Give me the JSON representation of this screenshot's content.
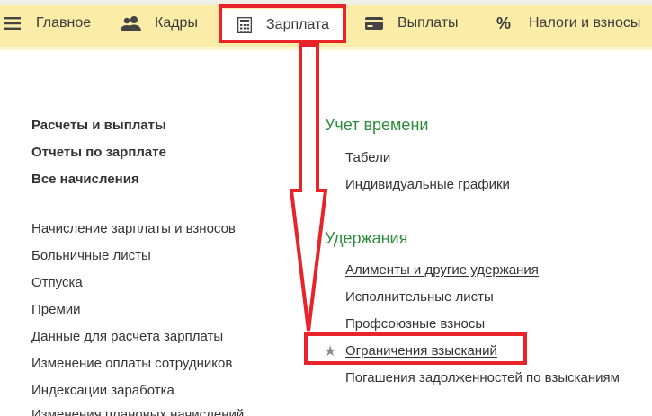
{
  "menu": {
    "items": [
      {
        "label": "Главное",
        "icon": "hamburger-icon"
      },
      {
        "label": "Кадры",
        "icon": "people-icon"
      },
      {
        "label": "Зарплата",
        "icon": "calculator-icon",
        "selected": true
      },
      {
        "label": "Выплаты",
        "icon": "card-icon"
      },
      {
        "label": "Налоги и взносы",
        "icon": "percent-icon",
        "glyph": "%"
      }
    ]
  },
  "left": {
    "bold": [
      "Расчеты и выплаты",
      "Отчеты по зарплате",
      "Все начисления"
    ],
    "links": [
      "Начисление зарплаты и взносов",
      "Больничные листы",
      "Отпуска",
      "Премии",
      "Данные для расчета зарплаты",
      "Изменение оплаты сотрудников",
      "Индексации заработка",
      "Изменения плановых начислений"
    ]
  },
  "right": {
    "time_title": "Учет времени",
    "time_links": [
      "Табели",
      "Индивидуальные графики"
    ],
    "deduct_title": "Удержания",
    "deduct_links": [
      "Алименты и другие удержания",
      "Исполнительные листы",
      "Профсоюзные взносы",
      "Ограничения взысканий",
      "Погашения задолженностей по взысканиям"
    ],
    "favorite_glyph": "★"
  },
  "colors": {
    "menu_bg": "#fbeca8",
    "section_green": "#2e8b3c",
    "callout_red": "#e8232a"
  }
}
